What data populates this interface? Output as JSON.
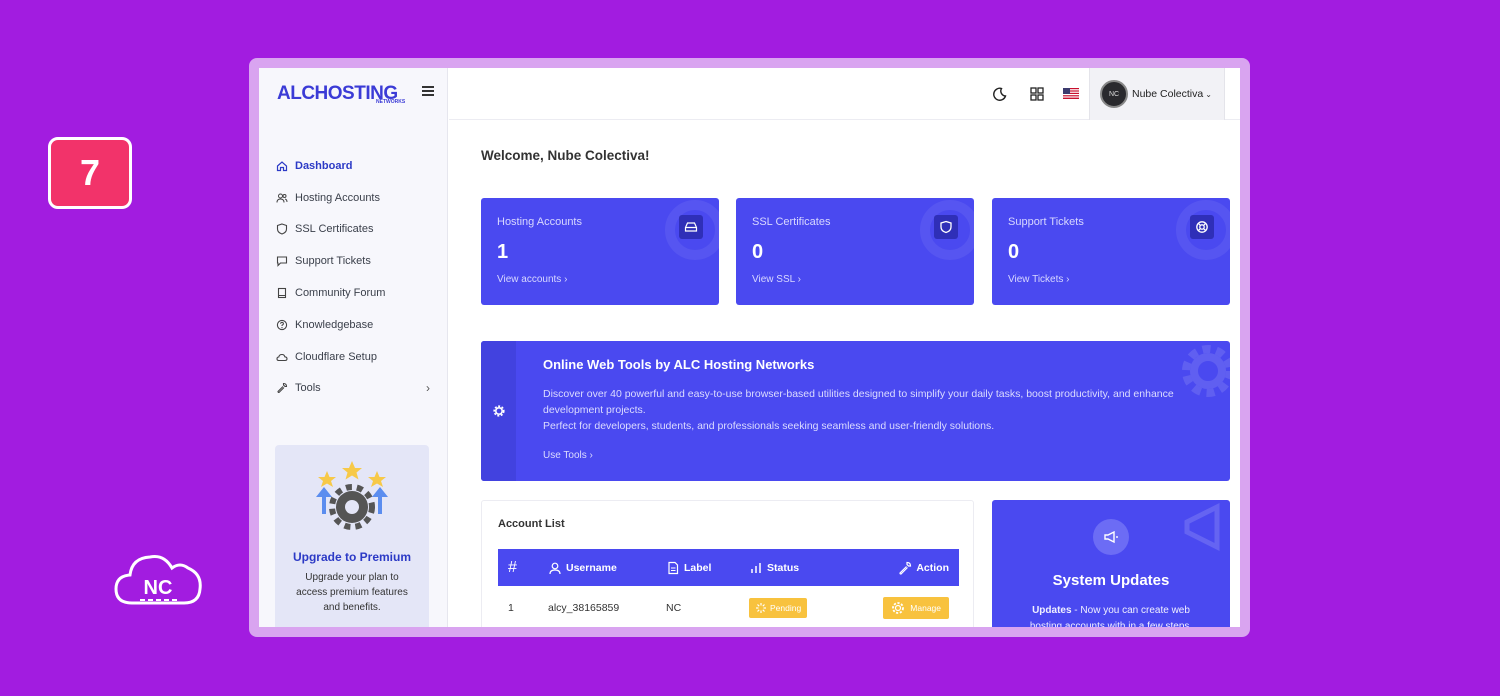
{
  "overlay": {
    "step_number": "7",
    "corner_logo_text": "NC"
  },
  "brand": {
    "logo_text": "ALCHOSTING",
    "logo_sub": "NETWORKS"
  },
  "sidebar": {
    "items": [
      {
        "label": "Dashboard",
        "icon": "home-icon",
        "active": true
      },
      {
        "label": "Hosting Accounts",
        "icon": "users-icon"
      },
      {
        "label": "SSL Certificates",
        "icon": "shield-icon"
      },
      {
        "label": "Support Tickets",
        "icon": "chat-icon"
      },
      {
        "label": "Community Forum",
        "icon": "book-icon"
      },
      {
        "label": "Knowledgebase",
        "icon": "help-circle-icon"
      },
      {
        "label": "Cloudflare Setup",
        "icon": "cloud-icon"
      },
      {
        "label": "Tools",
        "icon": "wrench-icon"
      }
    ],
    "upgrade": {
      "title": "Upgrade to Premium",
      "text": "Upgrade your plan to access premium features and benefits."
    }
  },
  "topbar": {
    "user_name": "Nube Colectiva",
    "avatar_text": "NC"
  },
  "main": {
    "welcome": "Welcome, Nube Colectiva!",
    "stats": [
      {
        "label": "Hosting Accounts",
        "value": "1",
        "link": "View accounts"
      },
      {
        "label": "SSL Certificates",
        "value": "0",
        "link": "View SSL"
      },
      {
        "label": "Support Tickets",
        "value": "0",
        "link": "View Tickets"
      }
    ],
    "tools": {
      "title": "Online Web Tools by ALC Hosting Networks",
      "line1": "Discover over 40 powerful and easy-to-use browser-based utilities designed to simplify your daily tasks, boost productivity, and enhance development projects.",
      "line2": "Perfect for developers, students, and professionals seeking seamless and user-friendly solutions.",
      "link": "Use Tools"
    },
    "accounts": {
      "title": "Account List",
      "columns": [
        "#",
        "Username",
        "Label",
        "Status",
        "Action"
      ],
      "rows": [
        {
          "num": "1",
          "username": "alcy_38165859",
          "label": "NC",
          "status": "Pending",
          "action": "Manage"
        }
      ]
    },
    "updates": {
      "title": "System Updates",
      "lead": "Updates",
      "text": " - Now you can create web hosting accounts with in a few steps."
    }
  },
  "colors": {
    "background": "#a21ce0",
    "primary": "#4a49f0",
    "badge": "#f8c23e",
    "step_badge": "#f2336a"
  }
}
